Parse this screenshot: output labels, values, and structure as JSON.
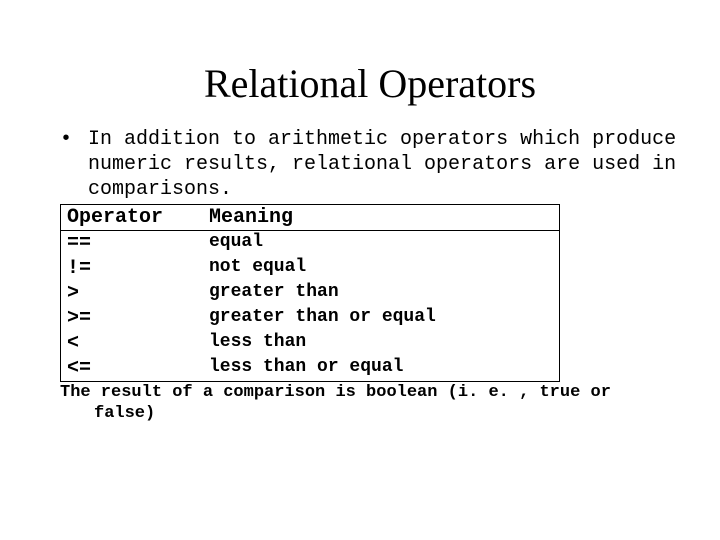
{
  "title": "Relational Operators",
  "bullet_text": "In addition to arithmetic operators which produce numeric results, relational operators are used in comparisons.",
  "table": {
    "headers": {
      "op": "Operator",
      "meaning": "Meaning"
    },
    "rows": [
      {
        "op": "==",
        "meaning": "equal"
      },
      {
        "op": "!=",
        "meaning": "not equal"
      },
      {
        "op": ">",
        "meaning": "greater than"
      },
      {
        "op": ">=",
        "meaning": "greater than or equal"
      },
      {
        "op": "<",
        "meaning": "less than"
      },
      {
        "op": "<=",
        "meaning": "less than or equal"
      }
    ]
  },
  "footnote": "The result of a comparison is boolean (i. e. , true or false)"
}
